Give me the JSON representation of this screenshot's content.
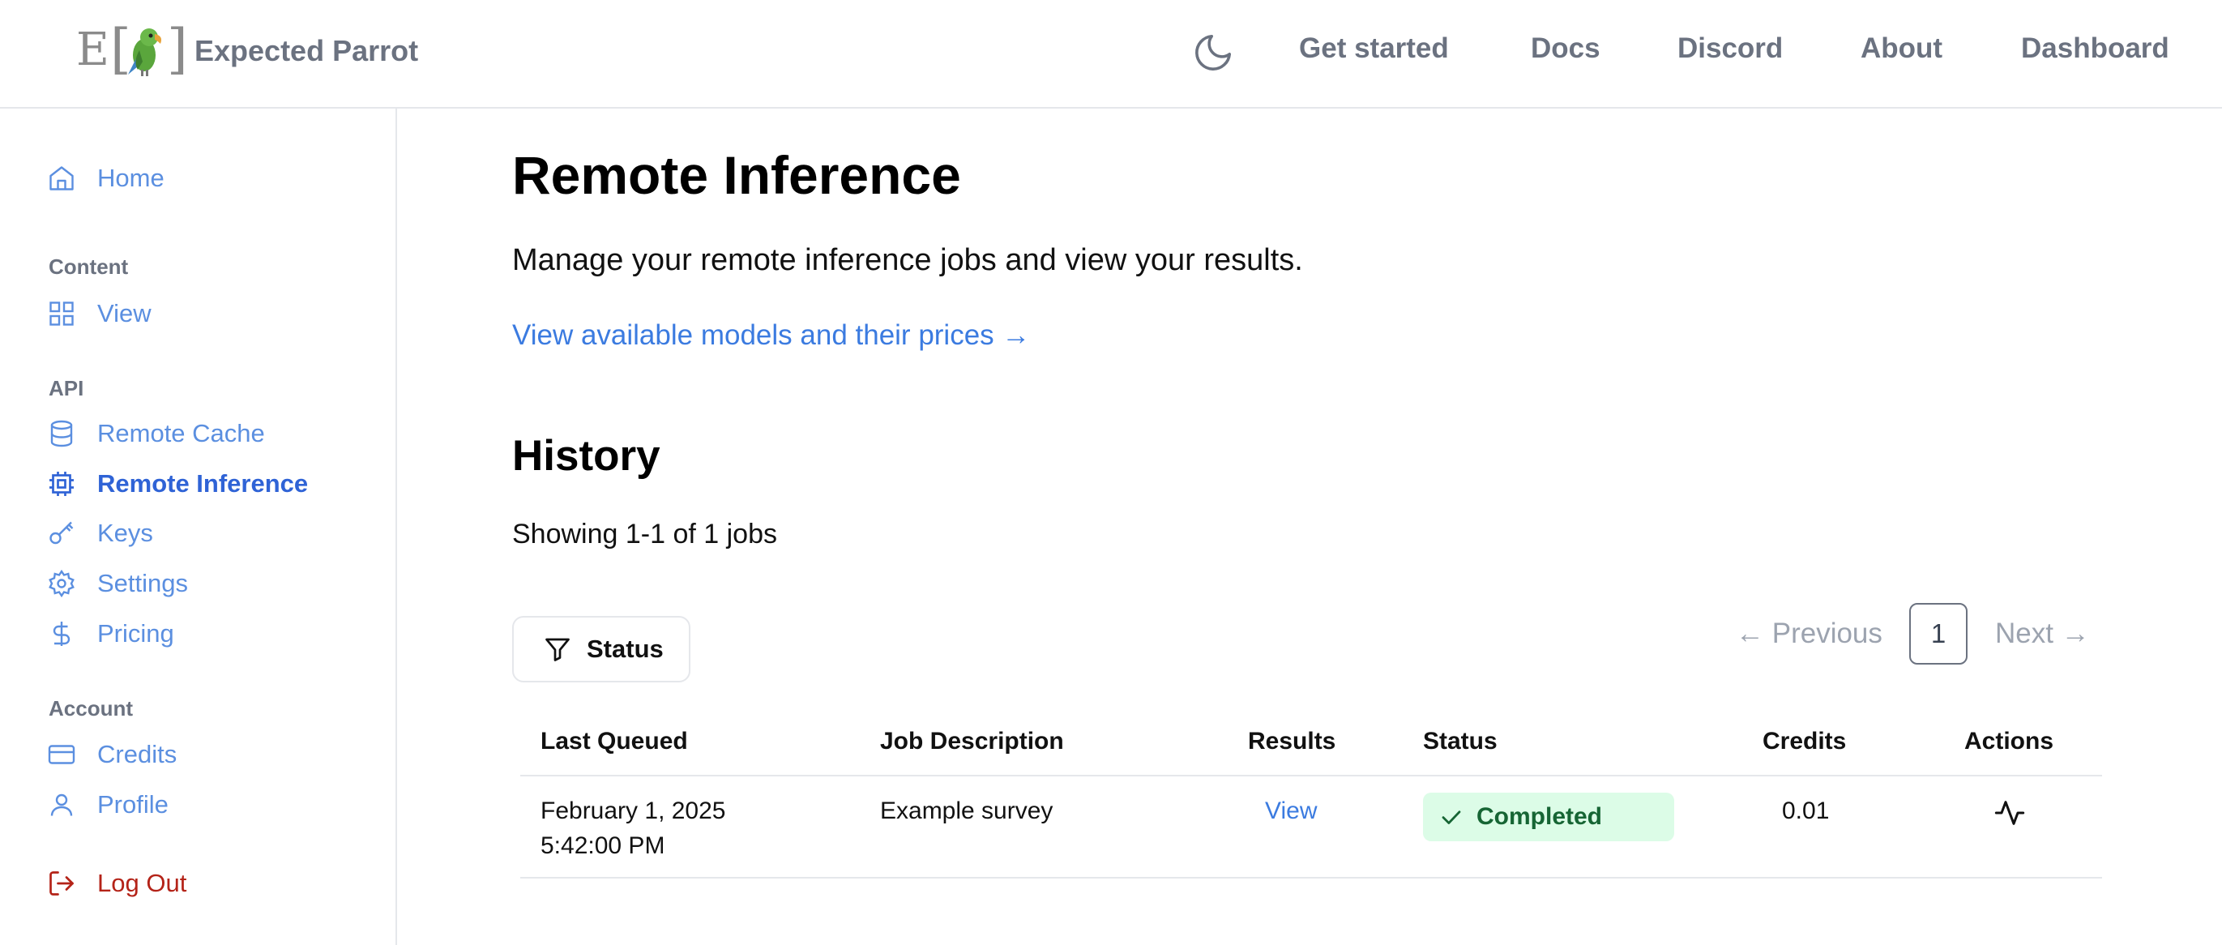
{
  "header": {
    "brand_name": "Expected Parrot",
    "logo_letter": "E",
    "logo_left_bracket": "[",
    "logo_right_bracket": "]",
    "nav": [
      "Get started",
      "Docs",
      "Discord",
      "About",
      "Dashboard"
    ],
    "theme_icon": "moon-icon"
  },
  "sidebar": {
    "home": "Home",
    "content_section": "Content",
    "view": "View",
    "api_section": "API",
    "remote_cache": "Remote Cache",
    "remote_inference": "Remote Inference",
    "keys": "Keys",
    "settings": "Settings",
    "pricing": "Pricing",
    "account_section": "Account",
    "credits": "Credits",
    "profile": "Profile",
    "logout": "Log Out"
  },
  "main": {
    "title": "Remote Inference",
    "subtitle": "Manage your remote inference jobs and view your results.",
    "models_link": "View available models and their prices →",
    "history_title": "History",
    "showing": "Showing 1-1 of 1 jobs",
    "filter_label": "Status",
    "pager": {
      "previous": "← Previous",
      "current_page": "1",
      "next": "Next →"
    },
    "table": {
      "headers": [
        "Last Queued",
        "Job Description",
        "Results",
        "Status",
        "Credits",
        "Actions"
      ],
      "rows": [
        {
          "date": "February 1, 2025",
          "time": "5:42:00 PM",
          "description": "Example survey",
          "results": "View",
          "status": "Completed",
          "credits": "0.01"
        }
      ]
    }
  },
  "colors": {
    "link": "#3b7be0",
    "sidebar_link": "#5b8fe0",
    "active": "#2f63d6",
    "logout": "#b42318",
    "badge_bg": "#dcfce7",
    "badge_text": "#166534"
  }
}
